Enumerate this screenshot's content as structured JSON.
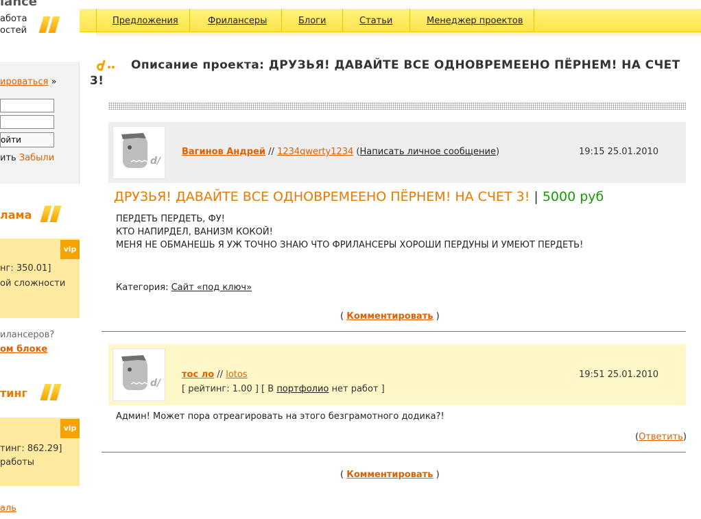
{
  "sidebar": {
    "logo_top": "lance",
    "logo_line1": "абота",
    "logo_line2": "остей",
    "login_link": "ироваться",
    "login_link_tail": "»",
    "login_button": "ойти",
    "remember_text": "ить",
    "forgot_link": "Забыли",
    "ads_title": "лама",
    "vip_label": "vip",
    "ad1_line1": "нг: 350.01]",
    "ad1_line2": "ой сложности",
    "question": "илансеров?",
    "block_link": "ом блоке",
    "rating_title": "тинг",
    "ad2_line1": "тинг: 862.29]",
    "ad2_line2": "работы",
    "bottom_link": "аль"
  },
  "nav": {
    "items": [
      "Предложения",
      "Фрилансеры",
      "Блоги",
      "Статьи",
      "Менеджер проектов"
    ]
  },
  "project": {
    "title_label": "Описание проекта:",
    "title_text": "ДРУЗЬЯ! ДАВАЙТЕ ВСЕ ОДНОВРЕМЕЕНО ПЁРНЕМ! НА СЧЕТ 3!",
    "author_name": "Вагинов Андрей",
    "author_sep": "//",
    "author_login": "1234qwerty1234",
    "private_msg": "Написать личное сообщение",
    "date": "19:15  25.01.2010",
    "name": "ДРУЗЬЯ! ДАВАЙТЕ ВСЕ ОДНОВРЕМЕЕНО ПЁРНЕМ! НА СЧЕТ 3!",
    "name_sep": "|",
    "price": "5000 руб",
    "description": [
      "ПЕРДЕТЬ ПЕРДЕТЬ, ФУ!",
      "КТО НАПИРДЕЛ, ВАНИЗМ КОКОЙ!",
      "МЕНЯ НЕ ОБМАНЕШЬ Я УЖ ТОЧНО ЗНАЮ ЧТО ФРИЛАНСЕРЫ ХОРОШИ ПЕРДУНЫ И УМЕЮТ ПЕРДЕТЬ!"
    ],
    "category_label": "Категория:",
    "category_value": "Сайт «под ключ»",
    "comment_link": "Комментировать"
  },
  "comment": {
    "author_name": "тос ло",
    "author_sep": "//",
    "author_login": "lotos",
    "rating_prefix": "[ рейтинг: 1.00 ] [ В",
    "portfolio_link": "портфолио",
    "rating_suffix": "нет работ ]",
    "date": "19:51  25.01.2010",
    "text": "Админ! Может пора отреагировать на этого безграмотного додика?!",
    "reply_link": "Ответить",
    "comment_link": "Комментировать"
  },
  "colors": {
    "accent_orange": "#e06000",
    "nav_yellow": "#ffe34f",
    "price_green": "#1a9a00",
    "comment_bg": "#fff7c8",
    "header_grey": "#eeeeee"
  }
}
